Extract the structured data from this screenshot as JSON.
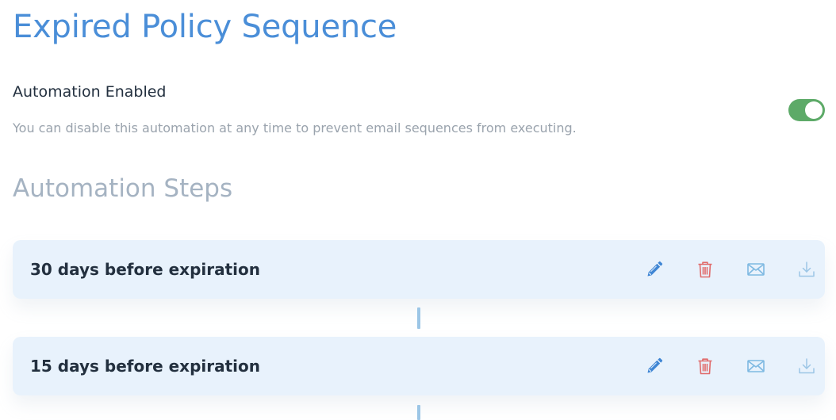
{
  "header": {
    "title": "Expired Policy Sequence"
  },
  "setting": {
    "title": "Automation Enabled",
    "description": "You can disable this automation at any time to prevent email sequences from executing.",
    "enabled": true,
    "toggle_color": "#5daa68"
  },
  "steps_section": {
    "title": "Automation Steps",
    "steps": [
      {
        "label": "30 days before expiration",
        "actions": [
          "pencil-icon",
          "trash-icon",
          "envelope-icon",
          "download-icon"
        ]
      },
      {
        "label": "15 days before expiration",
        "actions": [
          "pencil-icon",
          "trash-icon",
          "envelope-icon",
          "download-icon"
        ]
      }
    ]
  },
  "colors": {
    "title_blue": "#4a8ed8",
    "card_background": "#e8f2fc",
    "edit_icon": "#3f86d4",
    "delete_icon": "#e06a6a",
    "mail_icon": "#7eb9e2",
    "download_icon": "#9cc6e6"
  }
}
